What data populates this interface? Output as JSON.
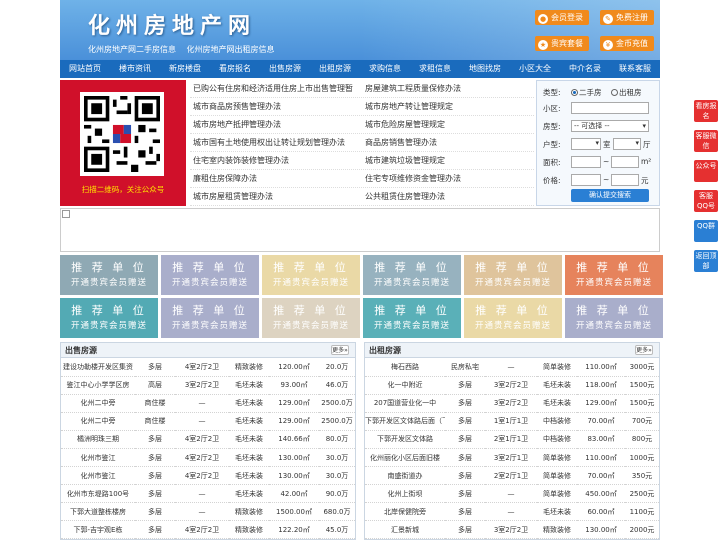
{
  "header": {
    "title": "化州房地产网",
    "subtitle": [
      "化州房地产网二手房信息",
      "化州房地产网出租房信息"
    ],
    "buttons": [
      {
        "label": "会员登录",
        "icon": "user-icon"
      },
      {
        "label": "免费注册",
        "icon": "register-icon"
      },
      {
        "label": "贵宾套餐",
        "icon": "vip-icon"
      },
      {
        "label": "金币充值",
        "icon": "coin-icon"
      }
    ]
  },
  "nav": [
    "网站首页",
    "楼市资讯",
    "新房楼盘",
    "看房报名",
    "出售房源",
    "出租房源",
    "求购信息",
    "求租信息",
    "地图找房",
    "小区大全",
    "中介名录",
    "联系客服"
  ],
  "qr": {
    "caption": "扫描二维码，关注公众号"
  },
  "links": [
    [
      "已购公有住房和经济适用住房上市出售管理暂",
      "房屋建筑工程质量保修办法"
    ],
    [
      "城市商品房预售管理办法",
      "城市房地产转让管理规定"
    ],
    [
      "城市房地产抵押管理办法",
      "城市危险房屋管理规定"
    ],
    [
      "城市国有土地使用权出让转让规划管理办法",
      "商品房销售管理办法"
    ],
    [
      "住宅室内装饰装修管理办法",
      "城市建筑垃圾管理规定"
    ],
    [
      "廉租住房保障办法",
      "住宅专项维修资金管理办法"
    ],
    [
      "城市房屋租赁管理办法",
      "公共租赁住房管理办法"
    ]
  ],
  "search": {
    "type_label": "类型:",
    "opt1": "二手房",
    "opt2": "出租房",
    "community_label": "小区:",
    "property_label": "房型:",
    "property_value": "-- 可选择 --",
    "layout_label": "户型:",
    "room_unit": "室",
    "hall_unit": "厅",
    "area_label": "面积:",
    "area_unit": "m²",
    "price_label": "价格:",
    "price_unit": "元",
    "submit": "确认提交搜索"
  },
  "tiles": {
    "line1": "推 荐 单 位",
    "line2": "开通贵宾会员赠送",
    "colors": [
      "#8fa9b4",
      "#a9aecb",
      "#ead9a6",
      "#97b2bf",
      "#dfc49c",
      "#e6835c",
      "#53aab4",
      "#a9aecb",
      "#ddd3c1",
      "#5ab0b8",
      "#ead9a6",
      "#a9aecb"
    ]
  },
  "sale": {
    "title": "出售房源",
    "more": "更多»",
    "rows": [
      [
        "建设功勒楼开发区集资",
        "多层",
        "4室2厅2卫",
        "精致装修",
        "120.00㎡",
        "20.0万"
      ],
      [
        "鉴江中心小学学区房",
        "高层",
        "3室2厅2卫",
        "毛坯未装",
        "93.00㎡",
        "46.0万"
      ],
      [
        "化州二中旁",
        "商住楼",
        "—",
        "毛坯未装",
        "129.00㎡",
        "2500.0万"
      ],
      [
        "化州二中旁",
        "商住楼",
        "—",
        "毛坯未装",
        "129.00㎡",
        "2500.0万"
      ],
      [
        "橘洲明珠三期",
        "多层",
        "4室2厅2卫",
        "毛坯未装",
        "140.66㎡",
        "80.0万"
      ],
      [
        "化州市鉴江",
        "多层",
        "4室2厅2卫",
        "毛坯未装",
        "130.00㎡",
        "30.0万"
      ],
      [
        "化州市鉴江",
        "多层",
        "4室2厅2卫",
        "毛坯未装",
        "130.00㎡",
        "30.0万"
      ],
      [
        "化州市东堤路100号",
        "多层",
        "—",
        "毛坯未装",
        "42.00㎡",
        "90.0万"
      ],
      [
        "下郭大道整栋楼房",
        "多层",
        "—",
        "精致装修",
        "1500.00㎡",
        "680.0万"
      ],
      [
        "下郭-吉宇观E栋",
        "多层",
        "4室2厅2卫",
        "精致装修",
        "122.20㎡",
        "45.0万"
      ]
    ]
  },
  "rent": {
    "title": "出租房源",
    "more": "更多»",
    "rows": [
      [
        "梅石西路",
        "民房私宅",
        "—",
        "简单装修",
        "110.00㎡",
        "3000元"
      ],
      [
        "化一中附近",
        "多层",
        "3室2厅2卫",
        "毛坯未装",
        "118.00㎡",
        "1500元"
      ],
      [
        "207国道营业化一中",
        "多层",
        "3室2厅2卫",
        "毛坯未装",
        "129.00㎡",
        "1500元"
      ],
      [
        "下郭开发区文体路后面（下郭",
        "多层",
        "1室1厅1卫",
        "中档装修",
        "70.00㎡",
        "700元"
      ],
      [
        "下郭开发区文体路",
        "多层",
        "2室1厅1卫",
        "中档装修",
        "83.00㎡",
        "800元"
      ],
      [
        "化州丽化小区后面旧楼",
        "多层",
        "3室2厅1卫",
        "简单装修",
        "110.00㎡",
        "1000元"
      ],
      [
        "南盛街道办",
        "多层",
        "2室2厅1卫",
        "简单装修",
        "70.00㎡",
        "350元"
      ],
      [
        "化州上街坝",
        "多层",
        "—",
        "简单装修",
        "450.00㎡",
        "2500元"
      ],
      [
        "北岸保健院旁",
        "多层",
        "—",
        "毛坯未装",
        "60.00㎡",
        "1100元"
      ],
      [
        "汇景新城",
        "多层",
        "3室2厅2卫",
        "精致装修",
        "130.00㎡",
        "2000元"
      ]
    ]
  },
  "sidebar": [
    {
      "label": "看房报名"
    },
    {
      "label": "客服微信"
    },
    {
      "label": "公众号"
    },
    {
      "label": "客服QQ号"
    },
    {
      "label": "QQ群"
    },
    {
      "label": "返回顶部"
    }
  ]
}
